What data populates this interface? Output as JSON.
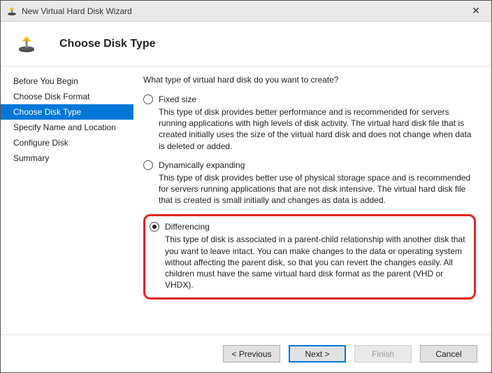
{
  "window": {
    "title": "New Virtual Hard Disk Wizard",
    "close_glyph": "✕"
  },
  "header": {
    "title": "Choose Disk Type"
  },
  "steps": [
    "Before You Begin",
    "Choose Disk Format",
    "Choose Disk Type",
    "Specify Name and Location",
    "Configure Disk",
    "Summary"
  ],
  "active_step_index": 2,
  "content": {
    "prompt": "What type of virtual hard disk do you want to create?",
    "options": [
      {
        "label": "Fixed size",
        "desc": "This type of disk provides better performance and is recommended for servers running applications with high levels of disk activity. The virtual hard disk file that is created initially uses the size of the virtual hard disk and does not change when data is deleted or added.",
        "selected": false
      },
      {
        "label": "Dynamically expanding",
        "desc": "This type of disk provides better use of physical storage space and is recommended for servers running applications that are not disk intensive. The virtual hard disk file that is created is small initially and changes as data is added.",
        "selected": false
      },
      {
        "label": "Differencing",
        "desc": "This type of disk is associated in a parent-child relationship with another disk that you want to leave intact. You can make changes to the data or operating system without affecting the parent disk, so that you can revert the changes easily. All children must have the same virtual hard disk format as the parent (VHD or VHDX).",
        "selected": true
      }
    ],
    "highlighted_option_index": 2
  },
  "footer": {
    "previous": "< Previous",
    "next": "Next >",
    "finish": "Finish",
    "cancel": "Cancel"
  }
}
